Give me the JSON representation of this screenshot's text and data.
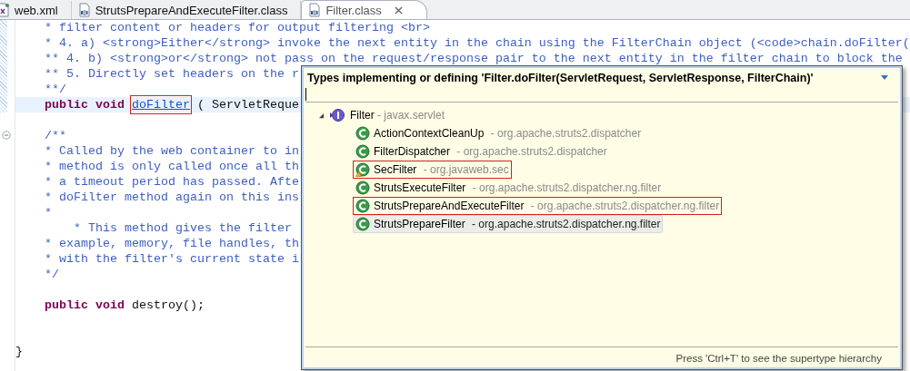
{
  "tabs": [
    {
      "label": "web.xml",
      "kind": "xml",
      "selected": false,
      "closable": false
    },
    {
      "label": "StrutsPrepareAndExecuteFilter.class",
      "kind": "class",
      "selected": false,
      "closable": false
    },
    {
      "label": "Filter.class",
      "kind": "class",
      "selected": true,
      "closable": true
    }
  ],
  "editor": {
    "lines": [
      {
        "current": false,
        "tokens": [
          {
            "kind": "comment",
            "text": "    * filter content or headers for output filtering <br>"
          }
        ]
      },
      {
        "current": false,
        "tokens": [
          {
            "kind": "comment",
            "text": "    * 4. a) <strong>Either</strong> invoke the next entity in the chain using the FilterChain object (<code>chain.doFilter("
          }
        ]
      },
      {
        "current": false,
        "tokens": [
          {
            "kind": "comment",
            "text": "    ** 4. b) <strong>or</strong> not pass on the request/response pair to the next entity in the filter chain to block the"
          }
        ]
      },
      {
        "current": false,
        "tokens": [
          {
            "kind": "comment",
            "text": "    ** 5. Directly set headers on the r"
          }
        ]
      },
      {
        "current": false,
        "tokens": [
          {
            "kind": "comment",
            "text": "    **/"
          }
        ]
      },
      {
        "current": true,
        "tokens": [
          {
            "kind": "keyword",
            "text": "    public void "
          },
          {
            "kind": "link",
            "text": "doFilter",
            "highlighted": true
          },
          {
            "kind": "plain",
            "text": " ( ServletReque"
          }
        ]
      },
      {
        "current": false
      },
      {
        "current": false,
        "foldable": true,
        "tokens": [
          {
            "kind": "comment",
            "text": "    /**"
          }
        ]
      },
      {
        "current": false,
        "tokens": [
          {
            "kind": "comment",
            "text": "    * Called by the web container to in"
          }
        ]
      },
      {
        "current": false,
        "tokens": [
          {
            "kind": "comment",
            "text": "    * method is only called once all th"
          }
        ]
      },
      {
        "current": false,
        "tokens": [
          {
            "kind": "comment",
            "text": "    * a timeout period has passed. Afte"
          }
        ]
      },
      {
        "current": false,
        "tokens": [
          {
            "kind": "comment",
            "text": "    * doFilter method again on this ins"
          }
        ]
      },
      {
        "current": false,
        "tokens": [
          {
            "kind": "comment",
            "text": "    *"
          }
        ]
      },
      {
        "current": false,
        "tokens": [
          {
            "kind": "comment",
            "text": "        * This method gives the filter"
          }
        ]
      },
      {
        "current": false,
        "tokens": [
          {
            "kind": "comment",
            "text": "    * example, memory, file handles, th"
          }
        ]
      },
      {
        "current": false,
        "tokens": [
          {
            "kind": "comment",
            "text": "    * with the filter's current state i"
          }
        ]
      },
      {
        "current": false,
        "tokens": [
          {
            "kind": "comment",
            "text": "    */"
          }
        ]
      },
      {
        "current": false
      },
      {
        "current": false,
        "tokens": [
          {
            "kind": "keyword",
            "text": "    public void "
          },
          {
            "kind": "plain",
            "text": "destroy();"
          }
        ]
      },
      {
        "current": false
      },
      {
        "current": false
      },
      {
        "current": false,
        "tokens": [
          {
            "kind": "plain",
            "text": "}"
          }
        ]
      }
    ]
  },
  "popup": {
    "title": "Types implementing or defining 'Filter.doFilter(ServletRequest, ServletResponse, FilterChain)'",
    "root": {
      "name": "Filter",
      "package": "- javax.servlet",
      "kind": "interface",
      "expanded": true,
      "children": [
        {
          "name": "ActionContextCleanUp",
          "package": "- org.apache.struts2.dispatcher",
          "kind": "class",
          "selected": false,
          "highlighted": false,
          "warning": false
        },
        {
          "name": "FilterDispatcher",
          "package": "- org.apache.struts2.dispatcher",
          "kind": "class",
          "selected": false,
          "highlighted": false,
          "warning": false
        },
        {
          "name": "SecFilter",
          "package": "- org.javaweb.sec",
          "kind": "class",
          "selected": false,
          "highlighted": true,
          "warning": true
        },
        {
          "name": "StrutsExecuteFilter",
          "package": "- org.apache.struts2.dispatcher.ng.filter",
          "kind": "class",
          "selected": false,
          "highlighted": false,
          "warning": false
        },
        {
          "name": "StrutsPrepareAndExecuteFilter",
          "package": "- org.apache.struts2.dispatcher.ng.filter",
          "kind": "class",
          "selected": false,
          "highlighted": true,
          "warning": false
        },
        {
          "name": "StrutsPrepareFilter",
          "package": "- org.apache.struts2.dispatcher.ng.filter",
          "kind": "class",
          "selected": true,
          "highlighted": false,
          "warning": false
        }
      ]
    },
    "footer": "Press 'Ctrl+T' to see the supertype hierarchy"
  }
}
